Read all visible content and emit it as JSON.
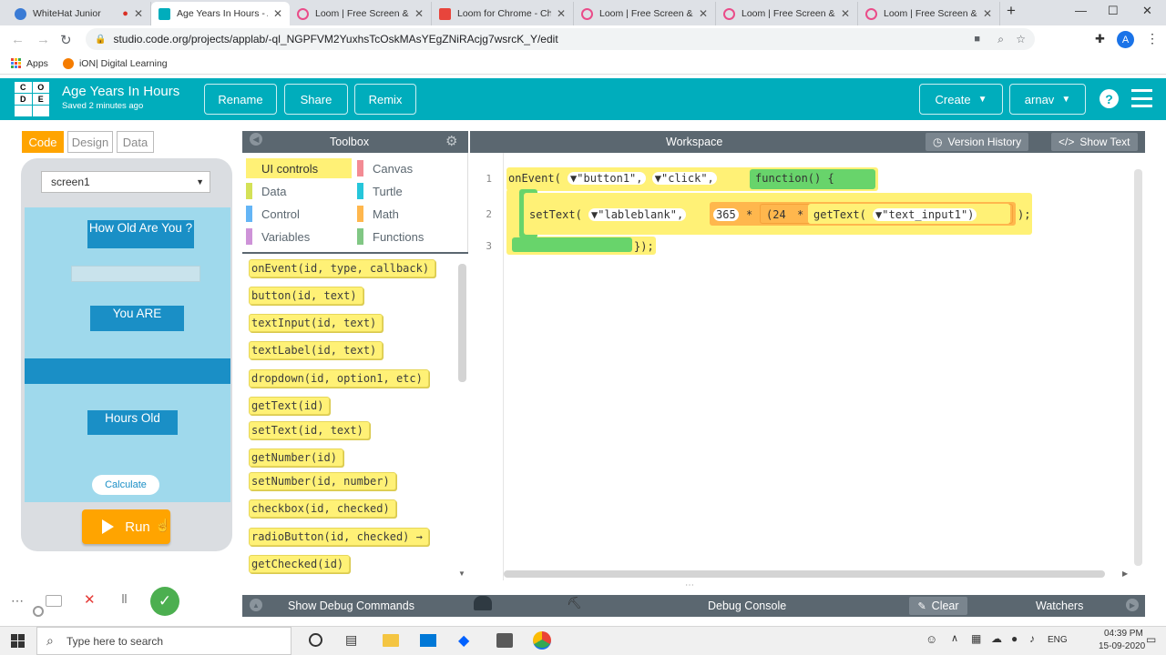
{
  "browser": {
    "tabs": [
      {
        "title": "WhiteHat Junior",
        "color": "#3a7bd5"
      },
      {
        "title": "Age Years In Hours - Ap",
        "color": "#00adbc"
      },
      {
        "title": "Loom | Free Screen & V",
        "color": "#ea4c89"
      },
      {
        "title": "Loom for Chrome - Chr",
        "color": "#e8453c"
      },
      {
        "title": "Loom | Free Screen & V",
        "color": "#ea4c89"
      },
      {
        "title": "Loom | Free Screen & V",
        "color": "#ea4c89"
      },
      {
        "title": "Loom | Free Screen & V",
        "color": "#ea4c89"
      }
    ],
    "url": "studio.code.org/projects/applab/-ql_NGPFVM2YuxhsTcOskMAsYEgZNiRAcjg7wsrcK_Y/edit",
    "bookmarks": [
      "Apps",
      "iON| Digital Learning"
    ],
    "profile_initial": "A"
  },
  "header": {
    "logo_letters": [
      "C",
      "O",
      "D",
      "E",
      "",
      ""
    ],
    "project_title": "Age Years In Hours",
    "saved": "Saved 2 minutes ago",
    "rename": "Rename",
    "share": "Share",
    "remix": "Remix",
    "create": "Create",
    "user": "arnav",
    "help": "?"
  },
  "modes": {
    "code": "Code",
    "design": "Design",
    "data": "Data"
  },
  "app": {
    "screen_select": "screen1",
    "label1": "How Old Are You ?",
    "label2": "You ARE",
    "label3": "Hours Old",
    "calculate": "Calculate",
    "run": "Run"
  },
  "toolbox": {
    "title": "Toolbox",
    "categories": [
      {
        "label": "UI controls",
        "color": "#fff176"
      },
      {
        "label": "Canvas",
        "color": "#f38b94"
      },
      {
        "label": "Data",
        "color": "#d4e157"
      },
      {
        "label": "Turtle",
        "color": "#26c6da"
      },
      {
        "label": "Control",
        "color": "#64b5f6"
      },
      {
        "label": "Math",
        "color": "#ffb74d"
      },
      {
        "label": "Variables",
        "color": "#ce93d8"
      },
      {
        "label": "Functions",
        "color": "#81c784"
      }
    ],
    "blocks": [
      "onEvent(id, type, callback)",
      "button(id, text)",
      "textInput(id, text)",
      "textLabel(id, text)",
      "dropdown(id, option1, etc)",
      "getText(id)",
      "setText(id, text)",
      "getNumber(id)",
      "setNumber(id, number)",
      "checkbox(id, checked)",
      "radioButton(id, checked) →",
      "getChecked(id)"
    ]
  },
  "workspace": {
    "title": "Workspace",
    "version_history": "Version History",
    "show_text": "Show Text",
    "line_numbers": [
      "1",
      "2",
      "3"
    ],
    "line1_prefix": "onEvent(",
    "line1_arg1": "▼\"button1\",",
    "line1_arg2": "▼\"click\",",
    "line1_fn": "function() {",
    "line2_prefix": "setText(",
    "line2_arg1": "▼\"lableblank\",",
    "line2_num": "365",
    "line2_op1": "*",
    "line2_paren": "(24",
    "line2_op2": "*",
    "line2_get": "getText(",
    "line2_arg2": "▼\"text_input1\")",
    "line2_close": ");",
    "line3": "});"
  },
  "bottom": {
    "show_debug": "Show Debug Commands",
    "debug_console": "Debug Console",
    "clear": "Clear",
    "watchers": "Watchers"
  },
  "taskbar": {
    "search_placeholder": "Type here to search",
    "lang": "ENG",
    "time": "04:39 PM",
    "date": "15-09-2020"
  }
}
